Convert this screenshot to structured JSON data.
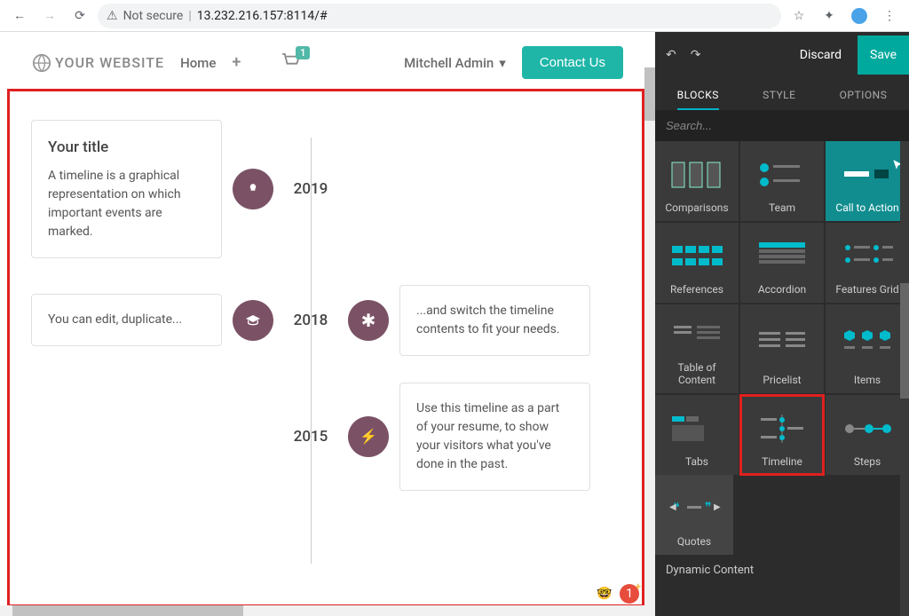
{
  "browser": {
    "not_secure": "Not secure",
    "url": "13.232.216.157:8114/#"
  },
  "header": {
    "site_name": "YOUR WEBSITE",
    "nav_home": "Home",
    "cart_count": "1",
    "user": "Mitchell Admin",
    "contact": "Contact Us"
  },
  "timeline": [
    {
      "title": "Your title",
      "left_text": "A timeline is a graphical representation on which important events are marked.",
      "year": "2019",
      "right_text": ""
    },
    {
      "title": "",
      "left_text": "You can edit, duplicate...",
      "year": "2018",
      "right_text": "...and switch the timeline contents to fit your needs."
    },
    {
      "title": "",
      "left_text": "",
      "year": "2015",
      "right_text": "Use this timeline as a part of your resume, to show your visitors what you've done in the past."
    }
  ],
  "panel": {
    "discard": "Discard",
    "save": "Save",
    "tabs": {
      "blocks": "BLOCKS",
      "style": "STYLE",
      "options": "OPTIONS"
    },
    "search_placeholder": "Search...",
    "section_dynamic": "Dynamic Content",
    "blocks": [
      "Comparisons",
      "Team",
      "Call to Action",
      "References",
      "Accordion",
      "Features Grid",
      "Table of Content",
      "Pricelist",
      "Items",
      "Tabs",
      "Timeline",
      "Steps",
      "Quotes"
    ]
  },
  "overlay": {
    "count": "1"
  }
}
